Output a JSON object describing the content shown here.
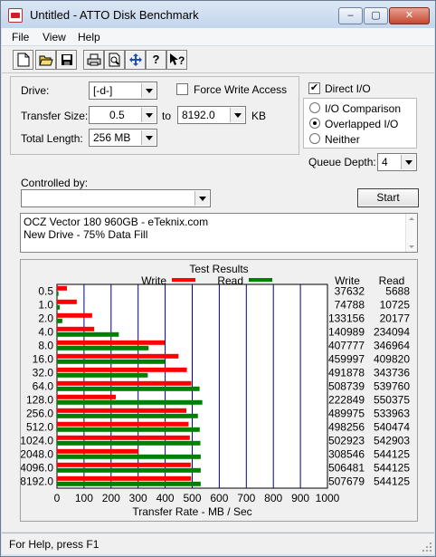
{
  "window": {
    "title": "Untitled - ATTO Disk Benchmark"
  },
  "caption": {
    "minimize": "–",
    "maximize": "▢",
    "close": "✕"
  },
  "menu": [
    "File",
    "View",
    "Help"
  ],
  "toolbar": [
    "new-icon",
    "open-icon",
    "save-icon",
    "print-icon",
    "print-preview-icon",
    "move-icon",
    "help-icon",
    "context-help-icon"
  ],
  "form": {
    "drive_label": "Drive:",
    "drive_value": "[-d-]",
    "force_write_label": "Force Write Access",
    "force_write_checked": false,
    "direct_io_label": "Direct I/O",
    "direct_io_checked": true,
    "transfer_size_label": "Transfer Size:",
    "transfer_from": "0.5",
    "to_label": "to",
    "transfer_to": "8192.0",
    "kb_label": "KB",
    "total_length_label": "Total Length:",
    "total_length_value": "256 MB",
    "io_comparison_label": "I/O Comparison",
    "overlapped_io_label": "Overlapped I/O",
    "neither_label": "Neither",
    "selected_mode": "Overlapped I/O",
    "queue_depth_label": "Queue Depth:",
    "queue_depth_value": "4",
    "controlled_by_label": "Controlled by:",
    "controlled_by_value": "",
    "start_label": "Start",
    "notes_line1": "OCZ Vector 180 960GB - eTeknix.com",
    "notes_line2": "New Drive - 75% Data Fill"
  },
  "colors": {
    "write": "#ff0000",
    "read": "#008000",
    "gridline": "#000080"
  },
  "chart_data": {
    "type": "bar",
    "title": "Test Results",
    "xlabel": "Transfer Rate - MB / Sec",
    "xlim": [
      0,
      1000
    ],
    "xticks": [
      "0",
      "100",
      "200",
      "300",
      "400",
      "500",
      "600",
      "700",
      "800",
      "900",
      "1000"
    ],
    "categories": [
      "0.5",
      "1.0",
      "2.0",
      "4.0",
      "8.0",
      "16.0",
      "32.0",
      "64.0",
      "128.0",
      "256.0",
      "512.0",
      "1024.0",
      "2048.0",
      "4096.0",
      "8192.0"
    ],
    "series": [
      {
        "name": "Write",
        "color": "#ff0000",
        "values": [
          36.75,
          73.04,
          130.04,
          137.68,
          398.2,
          449.2,
          480.3,
          496.8,
          217.6,
          478.5,
          486.6,
          491.1,
          301.4,
          494.6,
          495.8
        ]
      },
      {
        "name": "Read",
        "color": "#008000",
        "values": [
          5.56,
          10.47,
          19.7,
          228.6,
          338.8,
          400.2,
          335.7,
          527.1,
          537.3,
          521.0,
          527.8,
          530.2,
          531.4,
          531.4,
          531.4
        ]
      }
    ],
    "legend": {
      "write_label": "Write",
      "read_label": "Read"
    },
    "table": {
      "headers": [
        "Write",
        "Read"
      ],
      "rows": [
        [
          "37632",
          "5688"
        ],
        [
          "74788",
          "10725"
        ],
        [
          "133156",
          "20177"
        ],
        [
          "140989",
          "234094"
        ],
        [
          "407777",
          "346964"
        ],
        [
          "459997",
          "409820"
        ],
        [
          "491878",
          "343736"
        ],
        [
          "508739",
          "539760"
        ],
        [
          "222849",
          "550375"
        ],
        [
          "489975",
          "533963"
        ],
        [
          "498256",
          "540474"
        ],
        [
          "502923",
          "542903"
        ],
        [
          "308546",
          "544125"
        ],
        [
          "506481",
          "544125"
        ],
        [
          "507679",
          "544125"
        ]
      ]
    },
    "grid": true
  },
  "status": {
    "text": "For Help, press F1"
  }
}
